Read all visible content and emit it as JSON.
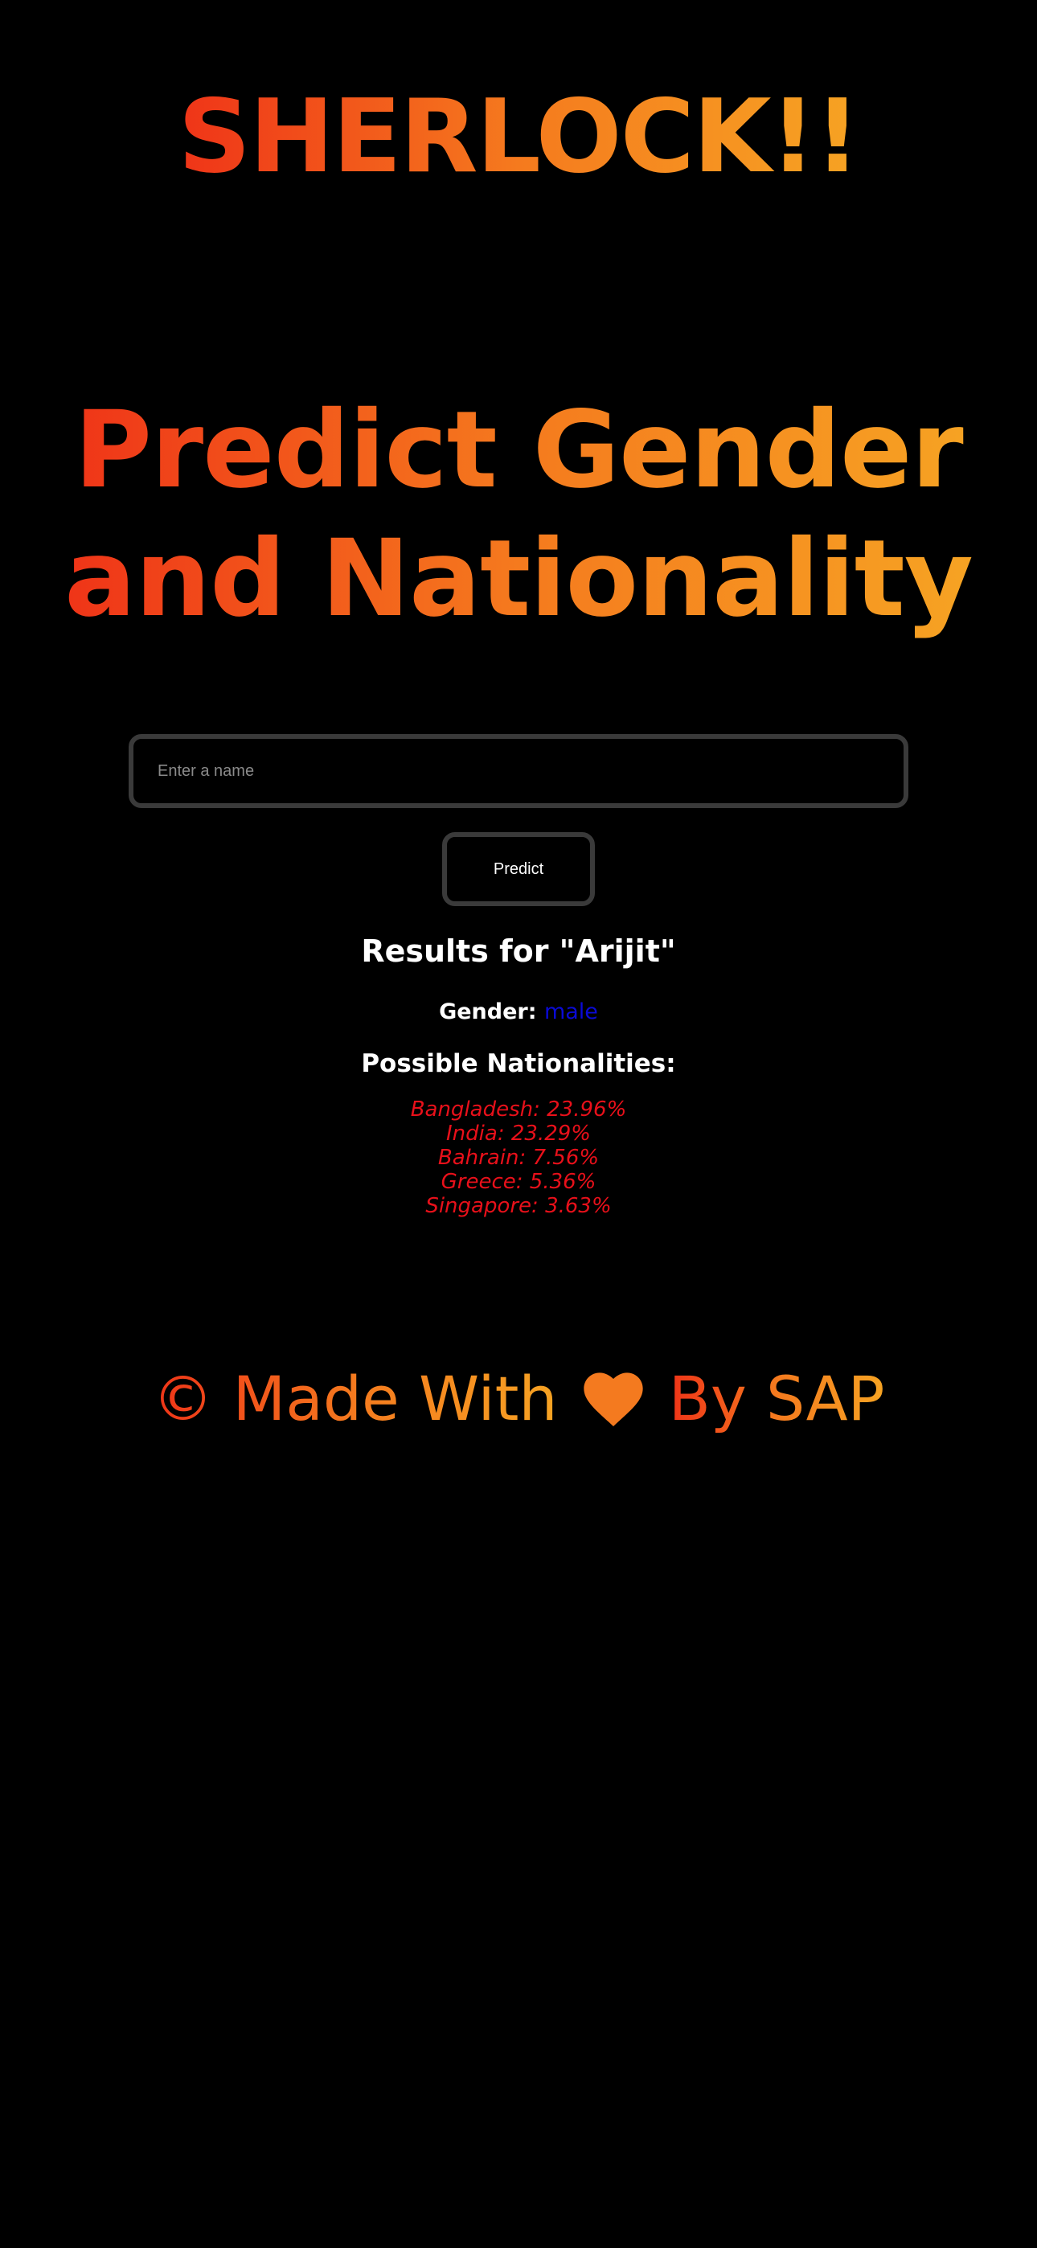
{
  "app": {
    "brand": "SHERLOCK!!"
  },
  "hero": {
    "line1": "Predict Gender",
    "line2": "and Nationality"
  },
  "form": {
    "name_placeholder": "Enter a name",
    "name_value": "",
    "predict_label": "Predict"
  },
  "results": {
    "title": "Results for \"Arijit\"",
    "gender_label": "Gender:",
    "gender_value": "male",
    "nationalities_title": "Possible Nationalities:",
    "nationalities": [
      "Bangladesh: 23.96%",
      "India: 23.29%",
      "Bahrain: 7.56%",
      "Greece: 5.36%",
      "Singapore: 3.63%"
    ]
  },
  "footer": {
    "before_heart": "© Made With",
    "after_heart": "By SAP",
    "icon": "heart-icon"
  },
  "colors": {
    "background": "#000000",
    "gradient_start": "#ef3418",
    "gradient_mid": "#f57a1e",
    "gradient_end": "#f6a323",
    "gender_value": "#0a0ad6",
    "nationality_text": "#e8101a",
    "heart": "#f47a1f"
  }
}
